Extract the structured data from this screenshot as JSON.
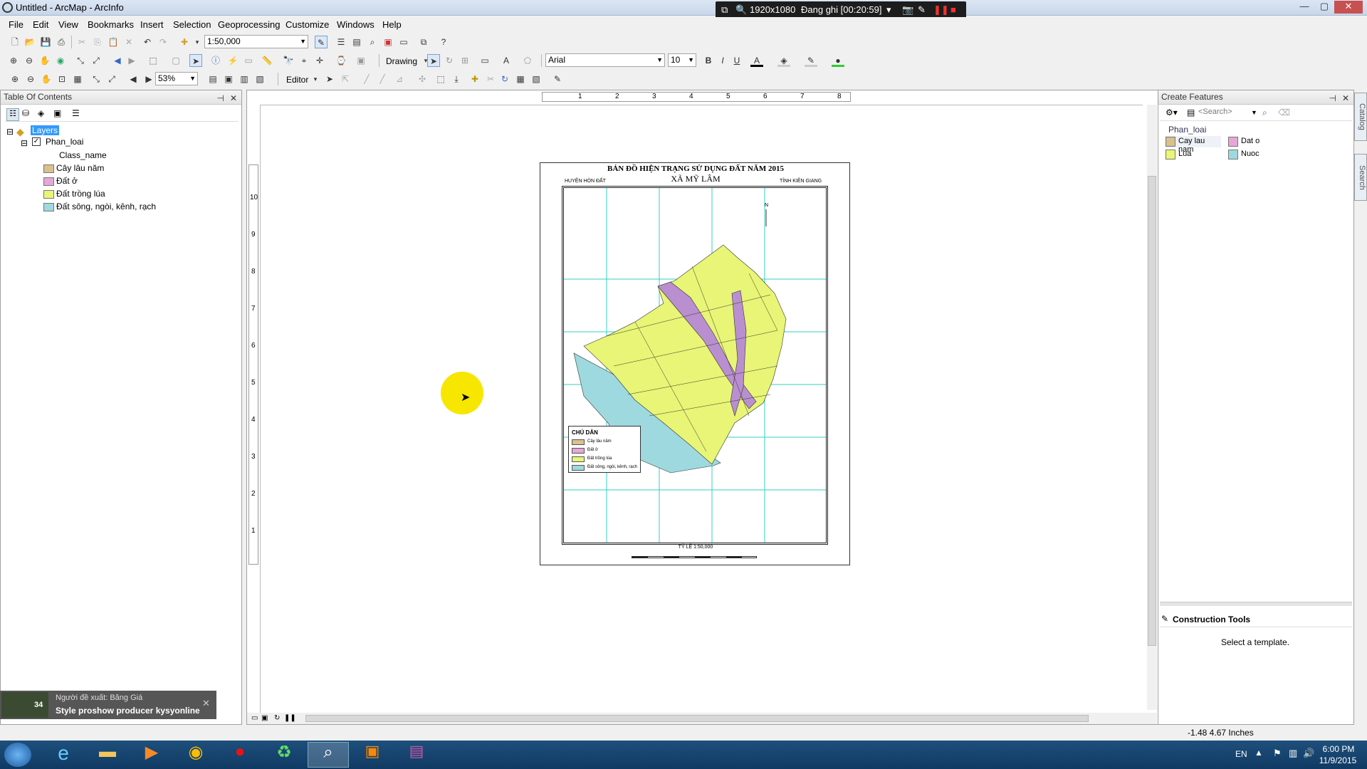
{
  "window": {
    "title": "Untitled - ArcMap - ArcInfo",
    "min": "—",
    "max": "▢",
    "close": "✕"
  },
  "recorder": {
    "resolution": "1920x1080",
    "status": "Đang ghi [00:20:59]"
  },
  "menu": [
    "File",
    "Edit",
    "View",
    "Bookmarks",
    "Insert",
    "Selection",
    "Geoprocessing",
    "Customize",
    "Windows",
    "Help"
  ],
  "toolbar": {
    "scale": "1:50,000",
    "drawing_label": "Drawing",
    "font": "Arial",
    "font_size": "10",
    "bold": "B",
    "italic": "I",
    "underline": "U",
    "zoom": "53%",
    "editor_label": "Editor"
  },
  "toc": {
    "title": "Table Of Contents",
    "root": "Layers",
    "layer": "Phan_loai",
    "field": "Class_name",
    "classes": [
      {
        "label": "Cây lâu năm",
        "color": "#d9c08c"
      },
      {
        "label": "Đất ở",
        "color": "#e6a7d6"
      },
      {
        "label": "Đất trồng lúa",
        "color": "#e8f576"
      },
      {
        "label": "Đất sông, ngòi, kênh, rạch",
        "color": "#9ed9df"
      }
    ]
  },
  "map": {
    "title": "BẢN ĐỒ HIỆN TRẠNG SỬ DỤNG ĐẤT NĂM 2015",
    "subtitle": "XÃ MỸ LÂM",
    "left_note": "HUYỆN HÒN ĐẤT",
    "right_note": "TỈNH KIÊN GIANG",
    "legend_title": "CHÚ DẪN",
    "legend": [
      "Cây lâu năm",
      "Đất ở",
      "Đất trồng lúa",
      "Đất sông, ngòi, kênh, rạch"
    ],
    "scale_text": "TỶ LỆ 1:50,000",
    "north": "N",
    "ruler_h": [
      "1",
      "2",
      "3",
      "4",
      "5",
      "6",
      "7",
      "8"
    ],
    "ruler_v": [
      "10",
      "9",
      "8",
      "7",
      "6",
      "5",
      "4",
      "3",
      "2",
      "1"
    ]
  },
  "create_features": {
    "title": "Create Features",
    "search_placeholder": "<Search>",
    "layer": "Phan_loai",
    "templates": [
      {
        "label": "Cay lau nam",
        "color": "#d9c08c"
      },
      {
        "label": "Dat o",
        "color": "#e6a7d6"
      },
      {
        "label": "Lua",
        "color": "#e8f576"
      },
      {
        "label": "Nuoc",
        "color": "#9ed9df"
      }
    ],
    "construction_title": "Construction Tools",
    "construction_hint": "Select a template."
  },
  "side_tabs": [
    "Catalog",
    "Search"
  ],
  "status": {
    "coords": "-1.48  4.67 Inches"
  },
  "toast": {
    "badge": "34",
    "line1": "Người đề xuất: Băng Giá",
    "line2": "Style proshow producer kysyonline"
  },
  "taskbar": {
    "lang": "EN",
    "time": "6:00 PM",
    "date": "11/9/2015"
  }
}
